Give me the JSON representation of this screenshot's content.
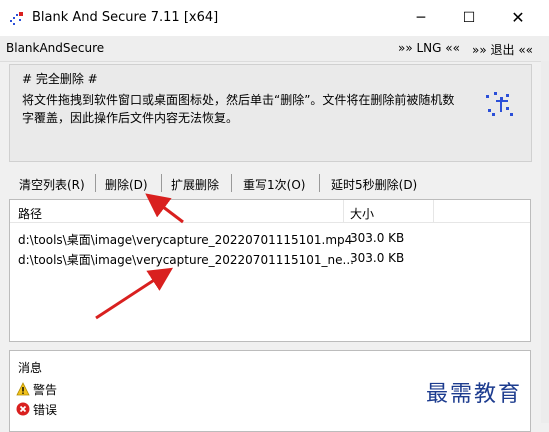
{
  "window": {
    "title": "Blank And Secure 7.11 [x64]",
    "icon": "shredder-app-icon",
    "buttons": {
      "minimize": "─",
      "maximize": "☐",
      "close": "✕"
    }
  },
  "menubar": {
    "app_name": "BlankAndSecure",
    "lng": "»» LNG ««",
    "exit": "»» 退出 ««"
  },
  "info": {
    "heading": "# 完全删除 #",
    "line1": "将文件拖拽到软件窗口或桌面图标处，然后单击“删除”。文件将在删除前被随机数",
    "line2": "字覆盖，因此操作后文件内容无法恢复。"
  },
  "toolbar": {
    "clear": "清空列表(R)",
    "delete": "删除(D)",
    "extended": "扩展删除",
    "rewrite": "重写1次(O)",
    "delay": "延时5秒删除(D)"
  },
  "filelist": {
    "columns": [
      "路径",
      "大小"
    ],
    "rows": [
      {
        "path": "d:\\tools\\桌面\\image\\verycapture_20220701115101.mp4",
        "size": "303.0 KB"
      },
      {
        "path": "d:\\tools\\桌面\\image\\verycapture_20220701115101_ne...",
        "size": "303.0 KB"
      }
    ]
  },
  "messages": {
    "title": "消息",
    "items": [
      {
        "icon": "warning-icon",
        "label": "警告"
      },
      {
        "icon": "error-icon",
        "label": "错误"
      }
    ]
  },
  "watermark": "最需教育",
  "colors": {
    "annotation_arrow": "#d9201f",
    "watermark": "#1d3c8f"
  }
}
